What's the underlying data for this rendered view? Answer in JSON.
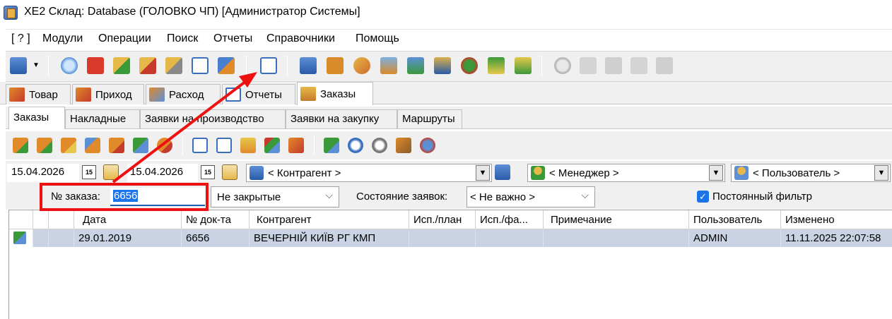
{
  "window": {
    "title": "XE2  Склад: Database (ГОЛОВКО ЧП) [Администратор Системы]"
  },
  "menu": {
    "items": [
      "[ ? ]",
      "Модули",
      "Операции",
      "Поиск",
      "Отчеты",
      "Справочники",
      "Помощь"
    ]
  },
  "module_tabs": {
    "items": [
      {
        "label": "Товар",
        "icon": "goods-icon"
      },
      {
        "label": "Приход",
        "icon": "income-icon"
      },
      {
        "label": "Расход",
        "icon": "expense-icon"
      },
      {
        "label": "Отчеты",
        "icon": "reports-icon"
      },
      {
        "label": "Заказы",
        "icon": "orders-icon",
        "active": true
      }
    ]
  },
  "sub_tabs": {
    "items": [
      {
        "label": "Заказы",
        "active": true
      },
      {
        "label": "Накладные"
      },
      {
        "label": "Заявки на производство"
      },
      {
        "label": "Заявки на закупку"
      },
      {
        "label": "Маршруты"
      }
    ]
  },
  "filters": {
    "date_from": "15.04.2026",
    "date_to": "15.04.2026",
    "counterparty": "< Контрагент >",
    "manager": "< Менеджер >",
    "user": "< Пользователь >",
    "order_number_label": "№ заказа:",
    "order_number_value": "6656",
    "closed_filter": "Не закрытые",
    "state_label": "Состояние заявок:",
    "state_value": "< Не важно >",
    "permanent_filter_label": "Постоянный фильтр",
    "permanent_filter_checked": true
  },
  "table": {
    "columns": [
      "Дата",
      "№ док-та",
      "Контрагент",
      "Исп./план",
      "Исп./фа...",
      "Примечание",
      "Пользователь",
      "Изменено"
    ],
    "rows": [
      {
        "date": "29.01.2019",
        "doc_no": "6656",
        "counterparty": "ВЕЧЕРНІЙ КИЇВ РГ КМП",
        "plan": "",
        "fact": "",
        "note": "",
        "user": "ADMIN",
        "changed": "11.11.2025 22:07:58"
      }
    ]
  },
  "colors": {
    "accent_red": "#e11111",
    "selected_row": "#c9d3e3",
    "checkbox_blue": "#1a73e8"
  }
}
